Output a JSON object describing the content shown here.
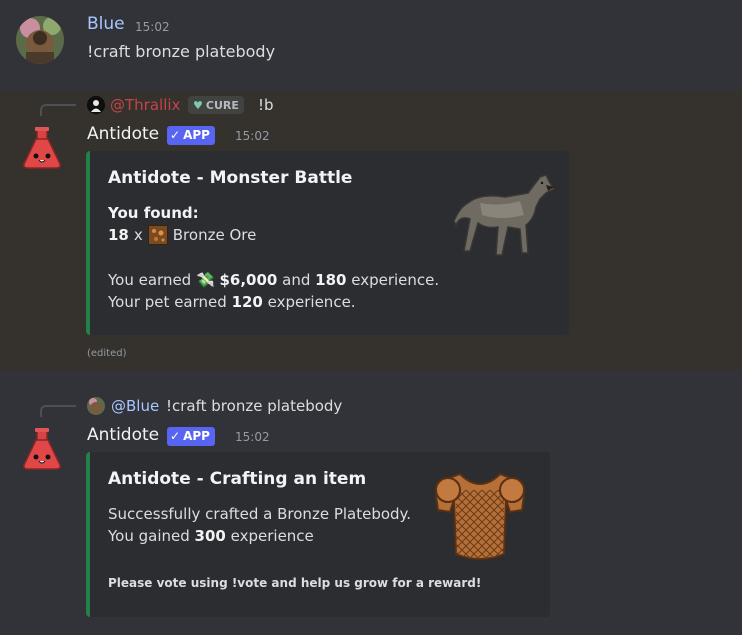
{
  "colors": {
    "background": "#313338",
    "highlight": "#35322d",
    "embed_bg": "#2b2d31",
    "embed_accent": "#248046",
    "username_blue": "#a9c6ff",
    "mention_red": "#c4434a",
    "app_badge": "#5865f2"
  },
  "msg1": {
    "author": "Blue",
    "timestamp": "15:02",
    "content": "!craft bronze platebody"
  },
  "msg2": {
    "reply": {
      "mention": "@Thrallix",
      "tag_icon": "heart-icon",
      "tag": "CURE",
      "text": "!b"
    },
    "author": "Antidote",
    "badge": "APP",
    "timestamp": "15:02",
    "embed": {
      "title": "Antidote - Monster Battle",
      "found_label": "You found:",
      "qty": "18",
      "x": "x",
      "item": "Bronze Ore",
      "earned_pre": "You earned",
      "money": "$6,000",
      "earned_mid": "and",
      "exp": "180",
      "earned_post": "experience.",
      "pet_pre": "Your pet earned",
      "pet_exp": "120",
      "pet_post": "experience.",
      "image": "wolf"
    },
    "edited": "(edited)"
  },
  "msg3": {
    "reply": {
      "mention": "@Blue",
      "text": "!craft bronze platebody"
    },
    "author": "Antidote",
    "badge": "APP",
    "timestamp": "15:02",
    "embed": {
      "title": "Antidote - Crafting an item",
      "line1": "Successfully crafted a Bronze Platebody.",
      "gained_pre": "You gained",
      "gained_exp": "300",
      "gained_post": "experience",
      "footer": "Please vote using !vote and help us grow for a reward!",
      "image": "bronze-platebody"
    }
  }
}
